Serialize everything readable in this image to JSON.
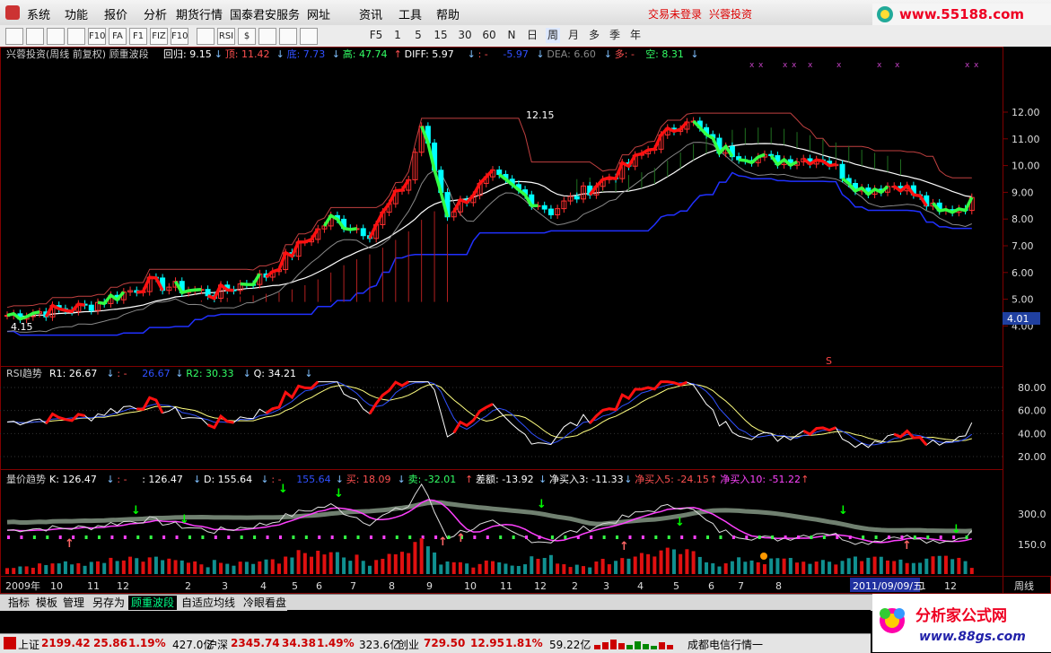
{
  "menu": {
    "items": [
      "系统",
      "功能",
      "报价",
      "分析",
      "期货行情",
      "国泰君安服务",
      "网址",
      "资讯",
      "工具",
      "帮助"
    ],
    "login_status": "交易未登录",
    "brand": "兴蓉投资",
    "logo_text": "www.55188.com"
  },
  "toolbar": {
    "icons": [
      "grid-icon",
      "table-icon",
      "line-chart-icon",
      "candle-icon",
      "f10-icon",
      "fa-icon",
      "f1-icon",
      "fiz-icon",
      "f10a-icon",
      "compare-icon",
      "rsi-icon",
      "dollar-icon",
      "move-icon",
      "export-icon",
      "pen-icon"
    ],
    "icon_labels": [
      "",
      "",
      "",
      "",
      "F10",
      "FA",
      "F1",
      "FIZ",
      "F10",
      "",
      "RSI",
      "$",
      "",
      "",
      ""
    ],
    "periods": [
      "F5",
      "1",
      "5",
      "15",
      "30",
      "60",
      "N",
      "日",
      "周",
      "月",
      "多",
      "季",
      "年"
    ],
    "active_period": "周"
  },
  "main_panel": {
    "title": "兴蓉投资(周线 前复权) 顾重波段",
    "indicators": [
      {
        "label": "回归: 9.15",
        "arrow": "↓",
        "color": "#ffffff"
      },
      {
        "label": "顶: 11.42",
        "arrow": "↓",
        "color": "#ff5050"
      },
      {
        "label": "底: 7.73",
        "arrow": "↓",
        "color": "#3050ff"
      },
      {
        "label": "高: 47.74",
        "arrow": "↑",
        "color": "#33ff66"
      },
      {
        "label": "DIFF: 5.97",
        "arrow": "↓",
        "color": "#ffffff"
      },
      {
        "label": ": -",
        "arrow": "",
        "color": "#ff5050"
      },
      {
        "label": "-5.97",
        "arrow": "↓",
        "color": "#3050ff"
      },
      {
        "label": "DEA: 6.60",
        "arrow": "↓",
        "color": "#888888"
      },
      {
        "label": "多: -",
        "arrow": "",
        "color": "#ff5050"
      },
      {
        "label": "空: 8.31",
        "arrow": "↓",
        "color": "#33ff66"
      }
    ],
    "peak_label": "12.15",
    "low_label": "4.15",
    "current_price": "4.01",
    "marker": "S"
  },
  "rsi_panel": {
    "title": "RSI趋势",
    "indicators": [
      {
        "label": "R1: 26.67",
        "arrow": "↓",
        "color": "#ffffff"
      },
      {
        "label": ": -",
        "arrow": "",
        "color": "#ff5050"
      },
      {
        "label": "26.67",
        "arrow": "↓",
        "color": "#3050ff"
      },
      {
        "label": "R2: 30.33",
        "arrow": "↓",
        "color": "#33ff66"
      },
      {
        "label": "Q: 34.21",
        "arrow": "↓",
        "color": "#ffffff"
      }
    ]
  },
  "vol_panel": {
    "title": "量价趋势",
    "indicators": [
      {
        "label": "K: 126.47",
        "arrow": "↓",
        "color": "#ffffff"
      },
      {
        "label": ": -",
        "arrow": "",
        "color": "#ff5050"
      },
      {
        "label": ": 126.47",
        "arrow": "↓",
        "color": "#ffffff"
      },
      {
        "label": "D: 155.64",
        "arrow": "↓",
        "color": "#ffffff"
      },
      {
        "label": ": -",
        "arrow": "",
        "color": "#ff5050"
      },
      {
        "label": "155.64",
        "arrow": "↓",
        "color": "#3050ff"
      },
      {
        "label": "买: 18.09",
        "arrow": "↓",
        "color": "#ff5050"
      },
      {
        "label": "卖: -32.01",
        "arrow": "↑",
        "color": "#33ff66"
      },
      {
        "label": "差额: -13.92",
        "arrow": "↓",
        "color": "#ffffff"
      },
      {
        "label": "净买入3: -11.33",
        "arrow": "↓",
        "color": "#ffffff"
      },
      {
        "label": "净买入5: -24.15",
        "arrow": "↑",
        "color": "#ff5050"
      },
      {
        "label": "净买入10: -51.22",
        "arrow": "↑",
        "color": "#ff44ff"
      }
    ]
  },
  "axes": {
    "main_ticks": [
      "12.00",
      "11.00",
      "10.00",
      "9.00",
      "8.00",
      "7.00",
      "6.00",
      "5.00",
      "4.00"
    ],
    "rsi_ticks": [
      "80.00",
      "60.00",
      "40.00",
      "20.00"
    ],
    "vol_ticks": [
      "300.0",
      "150.0"
    ],
    "x_labels": [
      "2009年",
      "10",
      "11",
      "12",
      "2",
      "3",
      "4",
      "5",
      "6",
      "7",
      "8",
      "9",
      "10",
      "11",
      "12",
      "2",
      "3",
      "4",
      "5",
      "6",
      "7",
      "8",
      "9",
      "10",
      "11",
      "12"
    ],
    "cursor_date": "2011/09/09/五",
    "period_label": "周线"
  },
  "tabs": [
    "指标",
    "模板",
    "管理",
    "另存为",
    "顾重波段",
    "自适应均线",
    "冷眼看盘"
  ],
  "active_tab": "顾重波段",
  "status": {
    "sh_label": "上证",
    "sh_index": "2199.42",
    "sh_change": "25.86",
    "sh_pct": "1.19%",
    "sh_amount": "427.0亿",
    "sz_label": "沪深",
    "sz_index": "2345.74",
    "sz_change": "34.38",
    "sz_pct": "1.49%",
    "sz_amount": "323.6亿",
    "cy_label": "创业",
    "cy_index": "729.50",
    "cy_change": "12.95",
    "cy_pct": "1.81%",
    "cy_amount": "59.22亿",
    "feed": "成都电信行情一"
  },
  "ad_logo": {
    "title": "分析家公式网",
    "url": "www.88gs.com"
  },
  "colors": {
    "up": "#ff3030",
    "down": "#00ffff",
    "grid": "#800000",
    "green": "#33ff44"
  }
}
